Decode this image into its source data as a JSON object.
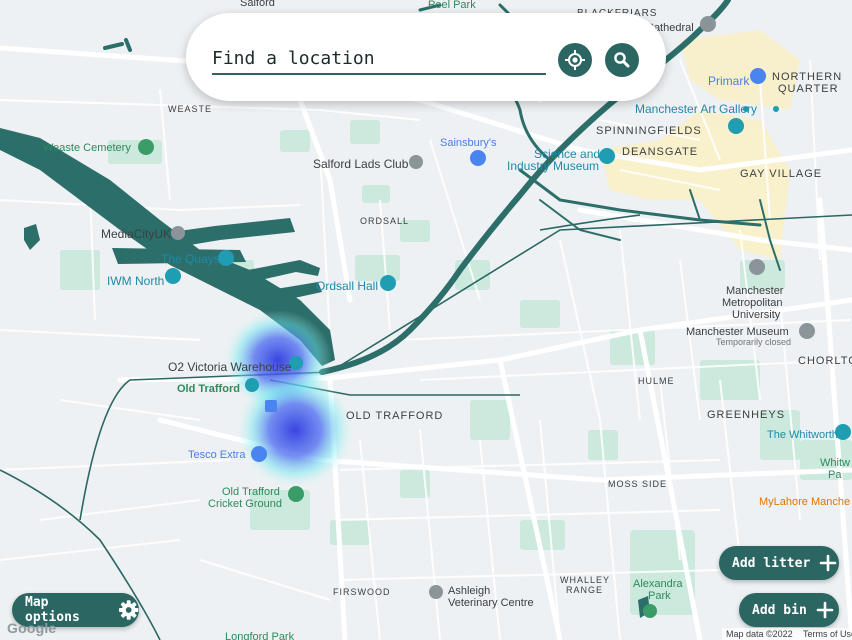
{
  "search": {
    "placeholder": "Find a location",
    "locate_icon": "crosshair-icon",
    "search_icon": "magnifier-icon"
  },
  "buttons": {
    "map_options": "Map options",
    "add_litter": "Add litter",
    "add_bin": "Add bin"
  },
  "map": {
    "place_labels": {
      "salford_top": "Salford",
      "peel_park": "Peel Park",
      "blackfriars": "BLACKFRIARS",
      "cathedral": "Cathedral",
      "weaste": "WEASTE",
      "primark": "Primark",
      "northern_quarter_1": "NORTHERN",
      "northern_quarter_2": "QUARTER",
      "manchester_art_gallery": "Manchester Art Gallery",
      "weaste_cemetery": "Weaste Cemetery",
      "sainsburys": "Sainsbury's",
      "spinningfields": "SPINNINGFIELDS",
      "salford_lads_club": "Salford Lads Club",
      "science_industry_1": "Science and",
      "science_industry_2": "Industry Museum",
      "deansgate": "DEANSGATE",
      "gay_village": "GAY VILLAGE",
      "ordsall": "ORDSALL",
      "mediacity": "MediaCityUK",
      "the_quays": "The Quays",
      "iwm_north": "IWM North",
      "ordsall_hall": "Ordsall Hall",
      "mmu_1": "Manchester",
      "mmu_2": "Metropolitan",
      "mmu_3": "University",
      "manchester_museum": "Manchester Museum",
      "temporarily_closed": "Temporarily closed",
      "chorlton": "CHORLTO",
      "o2_warehouse": "O2 Victoria Warehouse",
      "old_trafford_stn": "Old Trafford",
      "hulme": "HULME",
      "old_trafford_area": "OLD TRAFFORD",
      "greenheys": "GREENHEYS",
      "the_whitworth": "The Whitworth",
      "whitworth_park_1": "Whitw",
      "whitworth_park_2": "Pa",
      "tesco_extra": "Tesco Extra",
      "moss_side": "MOSS SIDE",
      "cricket_ground_1": "Old Trafford",
      "cricket_ground_2": "Cricket Ground",
      "mylahore": "MyLahore Manche",
      "firswood": "FIRSWOOD",
      "ashleigh_1": "Ashleigh",
      "ashleigh_2": "Veterinary Centre",
      "whalley_range_1": "WHALLEY",
      "whalley_range_2": "RANGE",
      "alexandra_park_1": "Alexandra",
      "alexandra_park_2": "Park",
      "longford_park": "Longford Park"
    }
  },
  "attribution": {
    "google": "Google",
    "map_data": "Map data ©2022",
    "terms": "Terms of Use"
  },
  "colors": {
    "accent": "#2b6663",
    "water": "#2c6e6a",
    "park": "#cbe9dc",
    "land": "#eef1f3",
    "heatmap_core": "#3a4be0",
    "heatmap_edge": "#66e9ee"
  }
}
